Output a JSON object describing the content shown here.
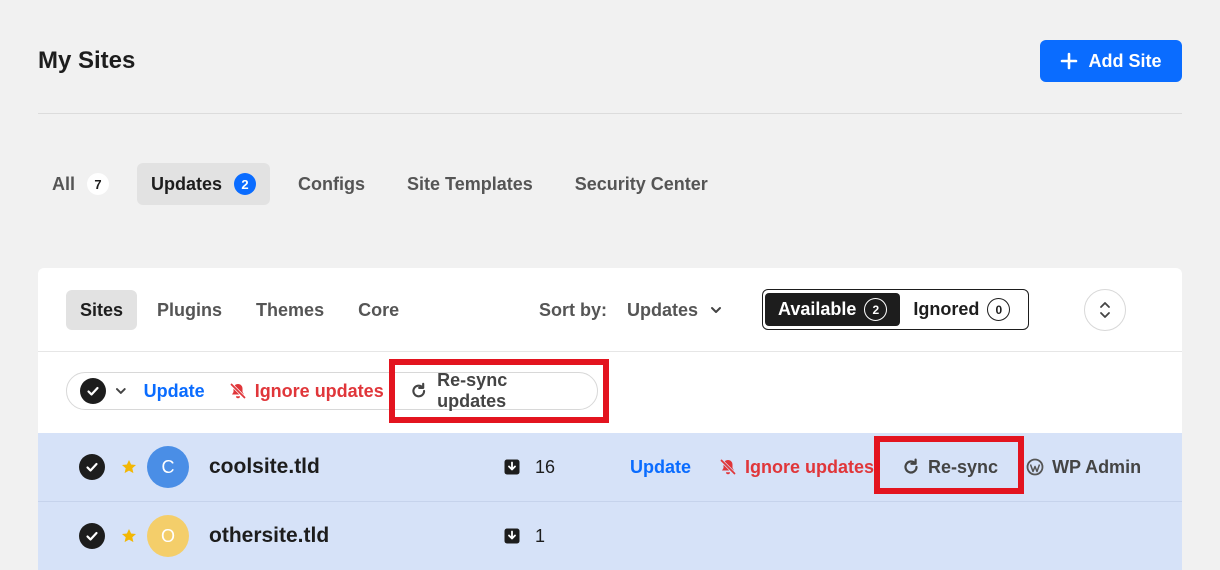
{
  "header": {
    "title": "My Sites",
    "add_site_label": "Add Site"
  },
  "tabs": [
    {
      "label": "All",
      "count": "7"
    },
    {
      "label": "Updates",
      "count": "2"
    },
    {
      "label": "Configs"
    },
    {
      "label": "Site Templates"
    },
    {
      "label": "Security Center"
    }
  ],
  "subtabs": [
    "Sites",
    "Plugins",
    "Themes",
    "Core"
  ],
  "sort": {
    "label": "Sort by:",
    "value": "Updates"
  },
  "filter": {
    "available_label": "Available",
    "available_count": "2",
    "ignored_label": "Ignored",
    "ignored_count": "0"
  },
  "bulk_actions": {
    "update_label": "Update",
    "ignore_label": "Ignore updates",
    "resync_label": "Re-sync updates"
  },
  "sites": [
    {
      "initial": "C",
      "name": "coolsite.tld",
      "updates": "16",
      "avatar_color": "#4a8ee6",
      "actions": {
        "update": "Update",
        "ignore": "Ignore updates",
        "resync": "Re-sync",
        "wp_admin": "WP Admin"
      }
    },
    {
      "initial": "O",
      "name": "othersite.tld",
      "updates": "1",
      "avatar_color": "#f4ce6a"
    }
  ],
  "colors": {
    "accent": "#0a6cff",
    "danger": "#e0363a",
    "highlight": "#e3141f",
    "selected_row": "#d6e2f8",
    "star": "#f2b705"
  }
}
